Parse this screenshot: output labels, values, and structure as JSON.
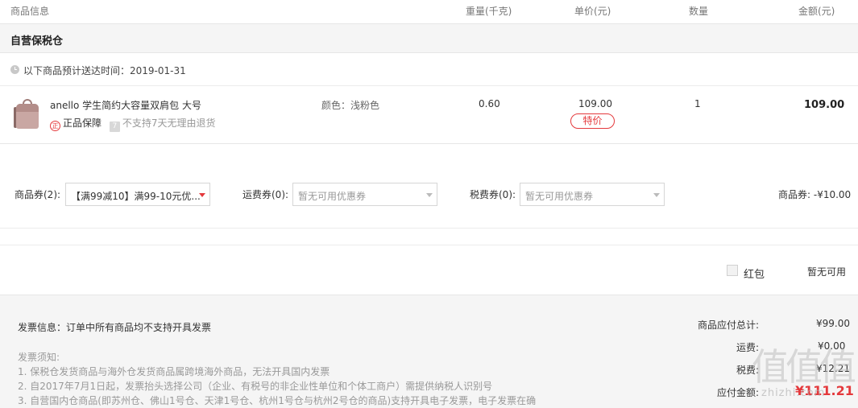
{
  "header": {
    "col_product": "商品信息",
    "col_weight": "重量(千克)",
    "col_unit_price": "单价(元)",
    "col_qty": "数量",
    "col_amount": "金额(元)"
  },
  "store": {
    "title": "自营保税仓"
  },
  "delivery": {
    "text": "以下商品预计送达时间：2019-01-31"
  },
  "product": {
    "name": "anello 学生简约大容量双肩包 大号",
    "genuine_icon_char": "正",
    "genuine_label": "正品保障",
    "noreturn_icon_char": "7",
    "noreturn_label": "不支持7天无理由退货",
    "spec": "颜色：浅粉色",
    "weight": "0.60",
    "unit_price": "109.00",
    "special_tag": "特价",
    "qty": "1",
    "amount": "109.00"
  },
  "coupons": {
    "goods_label": "商品券(2):",
    "goods_value": "【满99减10】满99-10元优...",
    "shipping_label": "运费券(0):",
    "shipping_value": "暂无可用优惠券",
    "tax_label": "税费券(0):",
    "tax_value": "暂无可用优惠券",
    "goods_discount": "商品券: -¥10.00"
  },
  "red_packet": {
    "label": "红包",
    "status": "暂无可用"
  },
  "invoice": {
    "info": "发票信息：订单中所有商品均不支持开具发票",
    "notes_title": "发票须知:",
    "notes": [
      "1. 保税仓发货商品与海外仓发货商品属跨境海外商品，无法开具国内发票",
      "2. 自2017年7月1日起，发票抬头选择公司（企业、有税号的非企业性单位和个体工商户）需提供纳税人识别号",
      "3. 自营国内仓商品(即苏州仓、佛山1号仓、天津1号仓、杭州1号仓与杭州2号仓的商品)支持开具电子发票，电子发票在确"
    ]
  },
  "summary": {
    "goods_total_label": "商品应付总计:",
    "goods_total": "¥99.00",
    "shipping_label": "运费:",
    "shipping": "¥0.00",
    "tax_label": "税费:",
    "tax": "¥12.21",
    "payable_label": "应付金额:",
    "payable": "¥111.21"
  },
  "watermark": {
    "glyphs": "值值值",
    "text": "zhizhi.com"
  },
  "colors": {
    "accent": "#e4393c",
    "panel_bg": "#f5f5f5",
    "border": "#e6e6e6"
  }
}
